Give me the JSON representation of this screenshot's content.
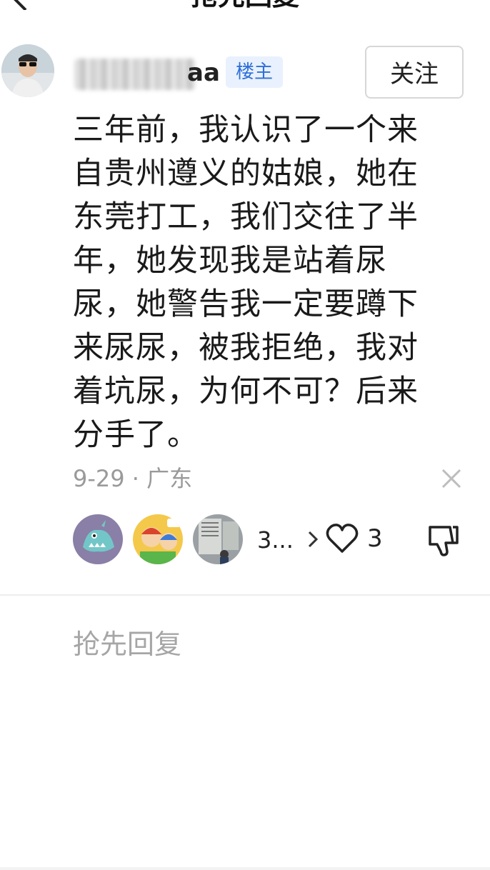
{
  "header": {
    "title": "抢先回复",
    "back_icon": "back-arrow-icon"
  },
  "post": {
    "author_name_visible": "aa",
    "author_badge": "楼主",
    "follow_label": "关注",
    "body": "三年前，我认识了一个来自贵州遵义的姑娘，她在东莞打工，我们交往了半年，她发现我是站着尿尿，她警告我一定要蹲下来尿尿，被我拒绝，我对着坑尿，为何不可？后来分手了。",
    "meta": "9-29 · 广东",
    "close_icon": "close-icon"
  },
  "reactions": {
    "reactor_count": "3...",
    "like_count": "3",
    "icons": [
      "chevron-right-icon",
      "heart-icon",
      "thumbs-down-icon"
    ]
  },
  "reply": {
    "placeholder": "抢先回复"
  },
  "colors": {
    "badge_text": "#2f6fd8",
    "badge_bg": "#e8f1fd",
    "muted": "#9a9a9a"
  }
}
